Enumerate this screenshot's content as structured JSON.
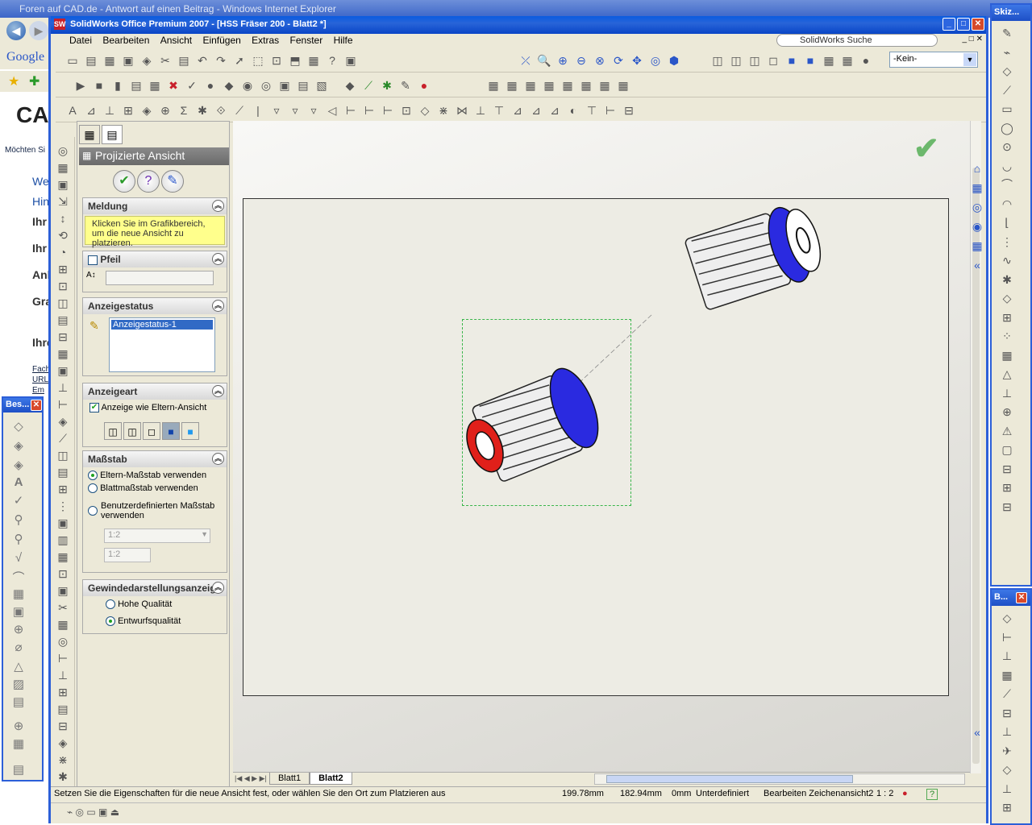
{
  "ie": {
    "title": "Foren auf CAD.de - Antwort auf einen Beitrag - Windows Internet Explorer",
    "google": "Google",
    "page_logo": "CA",
    "page_link": "Möchten Si",
    "page_lines": [
      "We",
      "Hin",
      "Ihr",
      "Ihr",
      "Anl",
      "Gra",
      "Ihre"
    ],
    "page_links": [
      "Fach",
      "URL",
      "Em"
    ]
  },
  "palette_left": {
    "title": "Bes..."
  },
  "palette_right_top": {
    "title": "Skiz..."
  },
  "palette_right_bottom": {
    "title": "B..."
  },
  "sw": {
    "title": "SolidWorks Office Premium 2007 - [HSS Fräser 200 - Blatt2 *]",
    "menu": [
      "Datei",
      "Bearbeiten",
      "Ansicht",
      "Einfügen",
      "Extras",
      "Fenster",
      "Hilfe"
    ],
    "search": "SolidWorks Suche",
    "config_select": "-Kein-"
  },
  "pm": {
    "header": "Projizierte Ansicht",
    "meldung": {
      "title": "Meldung",
      "text": "Klicken Sie im Grafikbereich, um die neue Ansicht zu platzieren."
    },
    "pfeil": {
      "title": "Pfeil",
      "checked": false,
      "value": ""
    },
    "anzeigestatus": {
      "title": "Anzeigestatus",
      "items": [
        "Anzeigestatus-1"
      ]
    },
    "anzeigeart": {
      "title": "Anzeigeart",
      "check_label": "Anzeige wie Eltern-Ansicht",
      "checked": true
    },
    "massstab": {
      "title": "Maßstab",
      "options": [
        "Eltern-Maßstab verwenden",
        "Blattmaßstab verwenden",
        "Benutzerdefinierten Maßstab verwenden"
      ],
      "selected": 0,
      "scale_select": "1:2",
      "scale_input": "1:2"
    },
    "gewinde": {
      "title": "Gewindedarstellungsanzeige",
      "options": [
        "Hohe Qualität",
        "Entwurfsqualität"
      ],
      "selected": 1
    }
  },
  "sheet_tabs": [
    "Blatt1",
    "Blatt2"
  ],
  "active_sheet": "Blatt2",
  "status": {
    "message": "Setzen Sie die Eigenschaften für die neue Ansicht fest, oder wählen Sie den Ort zum Platzieren aus",
    "x": "199.78mm",
    "y": "182.94mm",
    "z": "0mm",
    "state": "Unterdefiniert",
    "mode": "Bearbeiten Zeichenansicht2",
    "scale": "1 : 2"
  },
  "colors": {
    "accent_blue": "#2c5fd8",
    "msg_yellow": "#ffff8c",
    "gear_red": "#e0201a",
    "gear_blue": "#2a2ae0"
  }
}
